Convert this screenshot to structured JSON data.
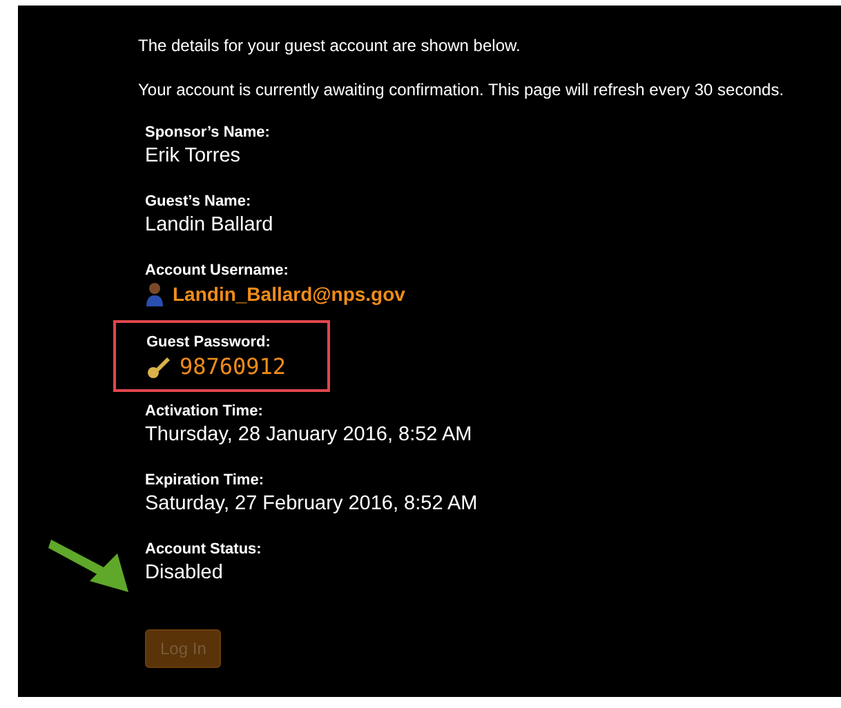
{
  "intro": [
    "The details for your guest account are shown below.",
    "Your account is currently awaiting confirmation. This page will refresh every 30 seconds."
  ],
  "fields": [
    {
      "kind": "text",
      "label": "Sponsor’s Name:",
      "value": "Erik Torres",
      "highlighted": false
    },
    {
      "kind": "text",
      "label": "Guest’s Name:",
      "value": "Landin Ballard",
      "highlighted": false
    },
    {
      "kind": "username",
      "label": "Account Username:",
      "value": "Landin_Ballard@nps.gov",
      "highlighted": false
    },
    {
      "kind": "password",
      "label": "Guest Password:",
      "value": "98760912",
      "highlighted": true
    },
    {
      "kind": "text",
      "label": "Activation Time:",
      "value": "Thursday, 28 January 2016, 8:52 AM",
      "highlighted": false
    },
    {
      "kind": "text",
      "label": "Expiration Time:",
      "value": "Saturday, 27 February 2016, 8:52 AM",
      "highlighted": false
    },
    {
      "kind": "status",
      "label": "Account Status:",
      "value": "Disabled",
      "highlighted": false
    }
  ],
  "login_button": {
    "label": "Log In",
    "disabled": true
  }
}
